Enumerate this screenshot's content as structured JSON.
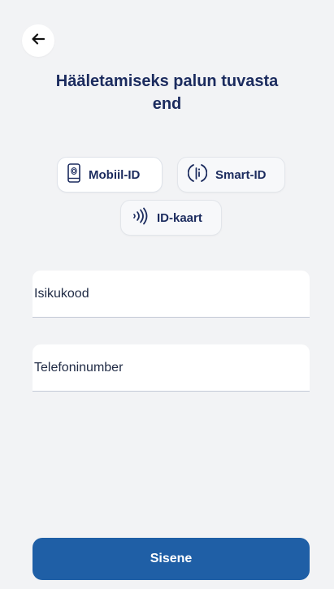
{
  "header": {
    "back_icon": "arrow-left-icon",
    "title": "Hääletamiseks palun tuvasta end"
  },
  "auth_methods": {
    "mobiil": {
      "label": "Mobiil-ID",
      "icon": "phone-fingerprint-icon",
      "selected": true
    },
    "smart": {
      "label": "Smart-ID",
      "icon": "smart-id-icon",
      "selected": false
    },
    "idkaart": {
      "label": "ID-kaart",
      "icon": "nfc-icon",
      "selected": false
    }
  },
  "form": {
    "isikukood_placeholder": "Isikukood",
    "telefon_placeholder": "Telefoninumber"
  },
  "submit_label": "Sisene",
  "colors": {
    "background": "#f2f3f5",
    "title": "#1b2b5e",
    "primary_button": "#1f5fa6"
  }
}
